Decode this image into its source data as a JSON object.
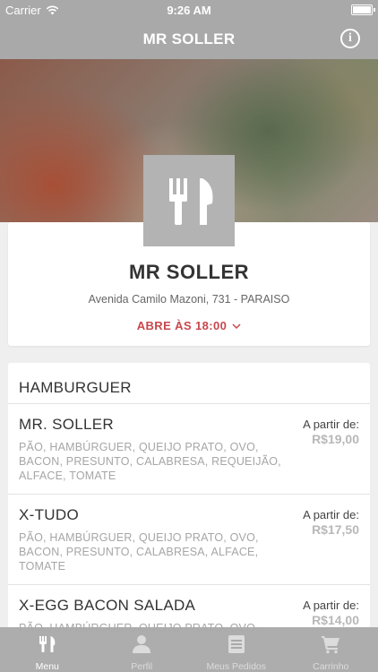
{
  "status_bar": {
    "carrier": "Carrier",
    "time": "9:26 AM"
  },
  "nav": {
    "title": "MR SOLLER",
    "info_icon": "info-icon"
  },
  "restaurant": {
    "logo_icon": "fork-knife-icon",
    "name": "MR SOLLER",
    "address": "Avenida Camilo Mazoni, 731 - PARAISO",
    "opening": "ABRE ÀS 18:00",
    "opening_icon": "chevron-down-icon"
  },
  "menu": {
    "category": "HAMBURGUER",
    "items": [
      {
        "name": "MR. SOLLER",
        "description": "PÃO, HAMBÚRGUER, QUEIJO PRATO, OVO, BACON, PRESUNTO, CALABRESA, REQUEIJÃO, ALFACE, TOMATE",
        "price_label": "A partir de:",
        "price": "R$19,00"
      },
      {
        "name": "X-TUDO",
        "description": "PÃO, HAMBÚRGUER, QUEIJO PRATO, OVO, BACON, PRESUNTO, CALABRESA, ALFACE, TOMATE",
        "price_label": "A partir de:",
        "price": "R$17,50"
      },
      {
        "name": "X-EGG BACON SALADA",
        "description": "PÃO, HAMBÚRGUER, QUEIJO PRATO, OVO,",
        "price_label": "A partir de:",
        "price": "R$14,00"
      }
    ]
  },
  "tabs": [
    {
      "label": "Menu",
      "icon": "fork-knife-icon",
      "active": true
    },
    {
      "label": "Perfil",
      "icon": "user-icon",
      "active": false
    },
    {
      "label": "Meus Pedidos",
      "icon": "orders-list-icon",
      "active": false
    },
    {
      "label": "Carrinho",
      "icon": "cart-icon",
      "active": false
    }
  ],
  "colors": {
    "accent": "#c8464c",
    "bar": "#a9a9a9"
  }
}
